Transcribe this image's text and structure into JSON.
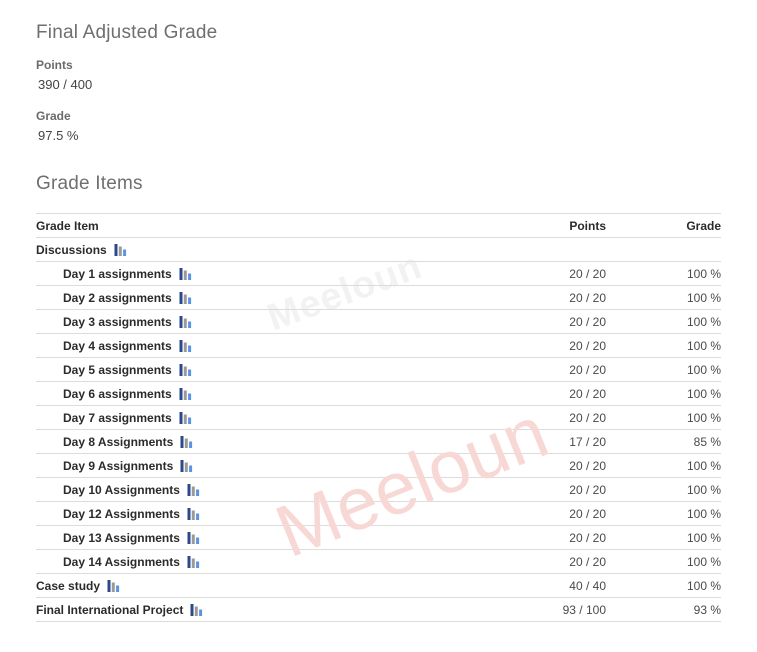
{
  "summary": {
    "title": "Final Adjusted Grade",
    "points_label": "Points",
    "points_value": "390 / 400",
    "grade_label": "Grade",
    "grade_value": "97.5 %"
  },
  "section": {
    "title": "Grade Items"
  },
  "table": {
    "columns": {
      "item": "Grade Item",
      "points": "Points",
      "grade": "Grade"
    },
    "icon_name": "bar-chart-icon",
    "rows": [
      {
        "name": "Discussions",
        "level": 0,
        "icon": "bar-chart-icon",
        "points": "",
        "grade": ""
      },
      {
        "name": "Day 1 assignments",
        "level": 1,
        "icon": "bar-chart-icon",
        "points": "20 / 20",
        "grade": "100 %"
      },
      {
        "name": "Day 2 assignments",
        "level": 1,
        "icon": "bar-chart-icon",
        "points": "20 / 20",
        "grade": "100 %"
      },
      {
        "name": "Day 3 assignments",
        "level": 1,
        "icon": "bar-chart-icon",
        "points": "20 / 20",
        "grade": "100 %"
      },
      {
        "name": "Day 4 assignments",
        "level": 1,
        "icon": "bar-chart-icon",
        "points": "20 / 20",
        "grade": "100 %"
      },
      {
        "name": "Day 5 assignments",
        "level": 1,
        "icon": "bar-chart-icon",
        "points": "20 / 20",
        "grade": "100 %"
      },
      {
        "name": "Day 6 assignments",
        "level": 1,
        "icon": "bar-chart-icon",
        "points": "20 / 20",
        "grade": "100 %"
      },
      {
        "name": "Day 7 assignments",
        "level": 1,
        "icon": "bar-chart-icon",
        "points": "20 / 20",
        "grade": "100 %"
      },
      {
        "name": "Day 8 Assignments",
        "level": 1,
        "icon": "bar-chart-icon",
        "points": "17 / 20",
        "grade": "85 %"
      },
      {
        "name": "Day 9 Assignments",
        "level": 1,
        "icon": "bar-chart-icon",
        "points": "20 / 20",
        "grade": "100 %"
      },
      {
        "name": "Day 10 Assignments",
        "level": 1,
        "icon": "bar-chart-icon",
        "points": "20 / 20",
        "grade": "100 %"
      },
      {
        "name": "Day 12 Assignments",
        "level": 1,
        "icon": "bar-chart-icon",
        "points": "20 / 20",
        "grade": "100 %"
      },
      {
        "name": "Day 13 Assignments",
        "level": 1,
        "icon": "bar-chart-icon",
        "points": "20 / 20",
        "grade": "100 %"
      },
      {
        "name": "Day 14 Assignments",
        "level": 1,
        "icon": "bar-chart-icon",
        "points": "20 / 20",
        "grade": "100 %"
      },
      {
        "name": "Case study",
        "level": 0,
        "icon": "bar-chart-icon",
        "points": "40 / 40",
        "grade": "100 %"
      },
      {
        "name": "Final International Project",
        "level": 0,
        "icon": "bar-chart-icon",
        "points": "93 / 100",
        "grade": "93 %"
      }
    ]
  },
  "watermarks": {
    "main": "Meeloun",
    "faint": "Meeloun"
  },
  "colors": {
    "icon_bar_dark": "#2b4a8b",
    "icon_bar_gray": "#9a9a9a",
    "icon_bar_light": "#5b92e5",
    "watermark_pink": "#f7d8d5",
    "rule": "#dcdcdc",
    "heading": "#6f6f6f"
  }
}
